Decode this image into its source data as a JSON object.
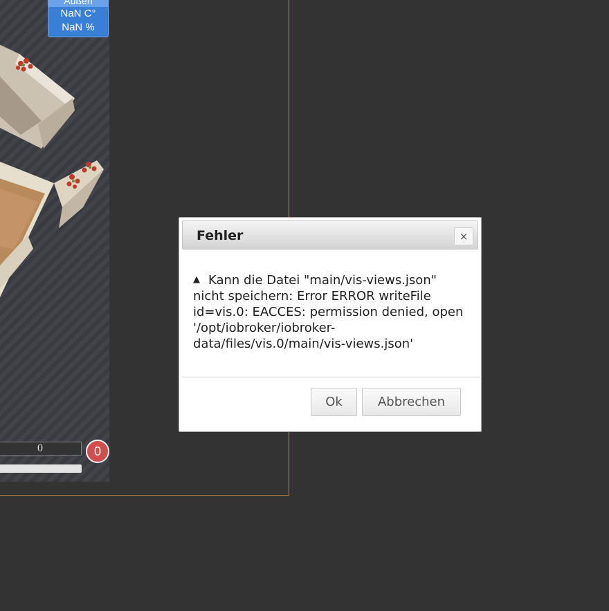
{
  "weather": {
    "label": "Außen",
    "temperature": "NaN C°",
    "humidity": "NaN %"
  },
  "counter": {
    "value": "0",
    "badge": "0"
  },
  "dialog": {
    "title": "Fehler",
    "close_icon": "×",
    "alert_icon": "▲",
    "message": "Kann die Datei \"main/vis-views.json\" nicht speichern: Error ERROR writeFile id=vis.0: EACCES: permission denied, open '/opt/iobroker/iobroker-data/files/vis.0/main/vis-views.json'",
    "ok_label": "Ok",
    "cancel_label": "Abbrechen"
  },
  "colors": {
    "background": "#333333",
    "frame_border": "#b8893f",
    "weather_blue": "#3a7fd6",
    "badge_red": "#d24e4e"
  }
}
